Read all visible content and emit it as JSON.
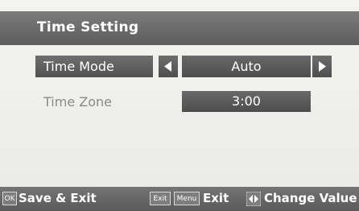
{
  "title": "Time Setting",
  "settings": [
    {
      "label": "Time Mode",
      "value": "Auto"
    },
    {
      "label": "Time Zone",
      "value": "3:00"
    }
  ],
  "footer": {
    "ok_key": "OK",
    "save_exit": "Save & Exit",
    "exit_key": "Exit",
    "menu_key": "Menu",
    "exit_label": "Exit",
    "change_value": "Change Value"
  },
  "colors": {
    "background": "#f1f1ee",
    "bar": "#666666",
    "text_light": "#ffffff",
    "text_dim": "#8a8a8a"
  },
  "icons": {
    "left": "left-arrow-icon",
    "right": "right-arrow-icon",
    "change": "left-right-arrows-icon"
  }
}
